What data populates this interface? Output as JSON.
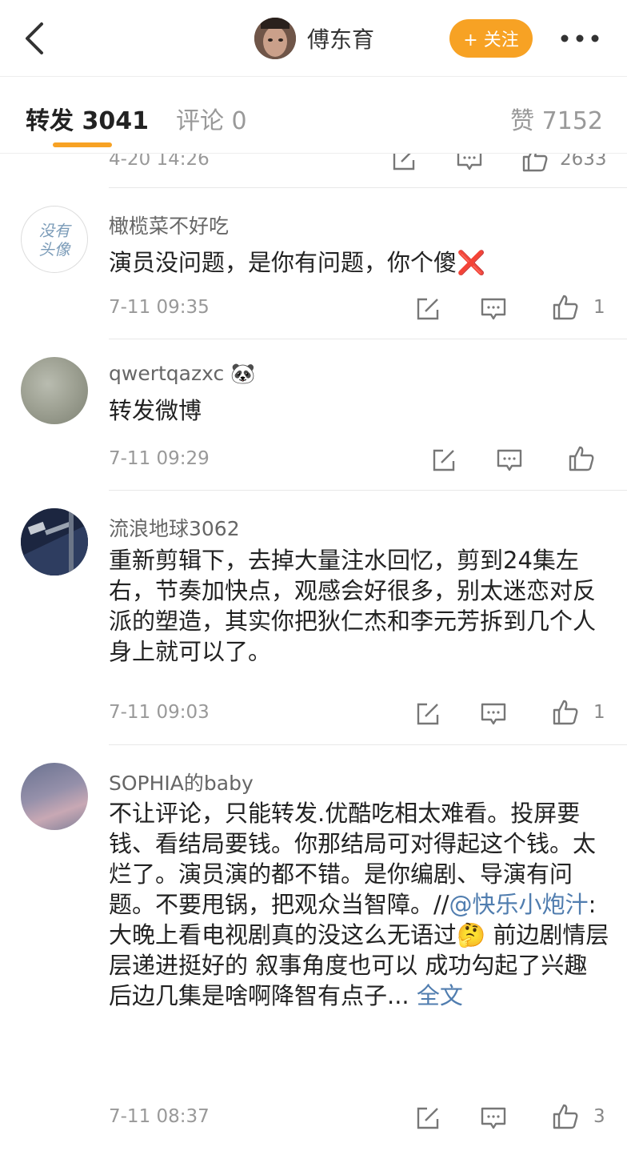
{
  "header": {
    "username": "傅东育",
    "follow_label": "+ 关注"
  },
  "tabs": {
    "repost": "转发 3041",
    "comment": "评论 0",
    "like": "赞 7152"
  },
  "partial_item": {
    "time": "4-20 14:26",
    "like_count": "2633"
  },
  "items": [
    {
      "name": "橄榄菜不好吃",
      "text": "演员没问题，是你有问题，你个傻❌",
      "time": "7-11 09:35",
      "like_count": "1",
      "avatar_text_1": "没有",
      "avatar_text_2": "头像"
    },
    {
      "name": "qwertqazxc 🐼",
      "text": "转发微博",
      "time": "7-11 09:29",
      "like_count": ""
    },
    {
      "name": "流浪地球3062",
      "text": "重新剪辑下，去掉大量注水回忆，剪到24集左右，节奏加快点，观感会好很多，别太迷恋对反派的塑造，其实你把狄仁杰和李元芳拆到几个人身上就可以了。",
      "time": "7-11 09:03",
      "like_count": "1"
    },
    {
      "name": "SOPHIA的baby",
      "text_before": "不让评论，只能转发.优酷吃相太难看。投屏要钱、看结局要钱。你那结局可对得起这个钱。太烂了。演员演的都不错。是你编剧、导演有问题。不要甩锅，把观众当智障。//",
      "mention": "@快乐小炮汁",
      "text_after": ":大晚上看电视剧真的没这么无语过🤔 前边剧情层层递进挺好的 叙事角度也可以 成功勾起了兴趣 后边几集是啥啊降智有点子...",
      "more_label": "全文",
      "time": "7-11 08:37",
      "like_count": "3"
    }
  ]
}
